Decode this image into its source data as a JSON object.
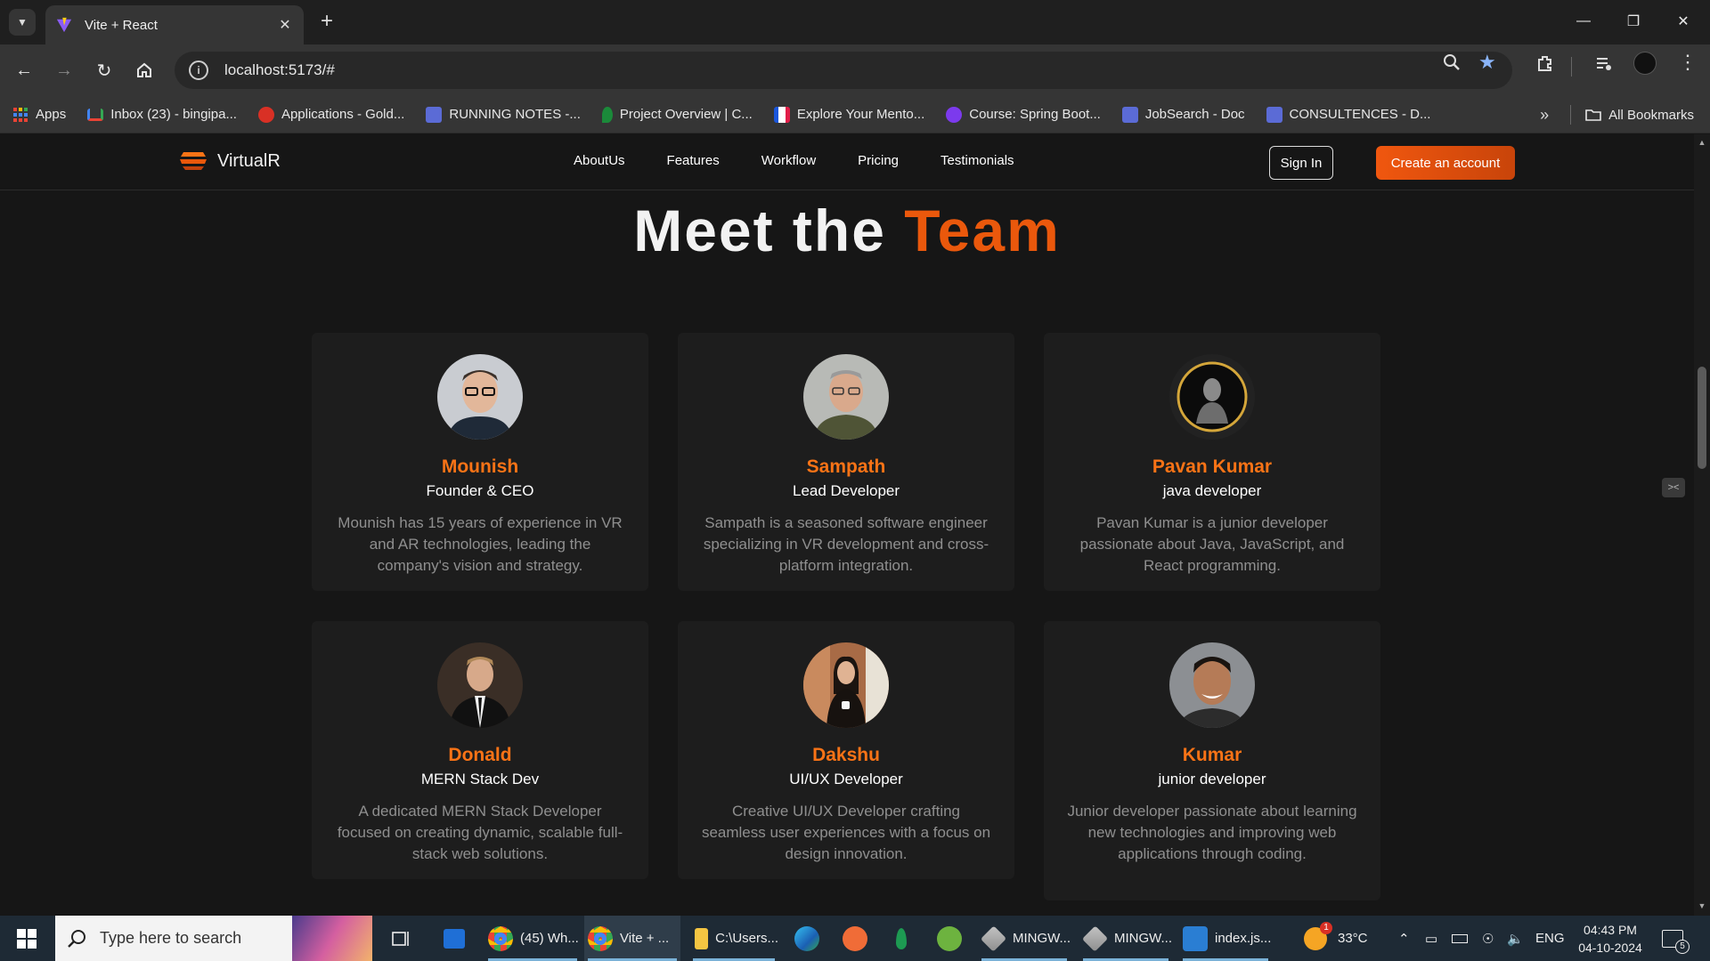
{
  "browser": {
    "tab_title": "Vite + React",
    "url": "localhost:5173/#",
    "bookmarks": [
      {
        "label": "Apps",
        "color": "#4285f4"
      },
      {
        "label": "Inbox (23) - bingipa...",
        "color": "#ea4335"
      },
      {
        "label": "Applications - Gold...",
        "color": "#d93025"
      },
      {
        "label": "RUNNING NOTES -...",
        "color": "#5b6bd6"
      },
      {
        "label": "Project Overview | C...",
        "color": "#1b8a3a"
      },
      {
        "label": "Explore Your Mento...",
        "color": "#e8e8e8"
      },
      {
        "label": "Course: Spring Boot...",
        "color": "#7c3aed"
      },
      {
        "label": "JobSearch - Doc",
        "color": "#5b6bd6"
      },
      {
        "label": "CONSULTENCES - D...",
        "color": "#5b6bd6"
      }
    ],
    "all_bookmarks": "All Bookmarks"
  },
  "site": {
    "brand": "VirtualR",
    "nav": [
      "AboutUs",
      "Features",
      "Workflow",
      "Pricing",
      "Testimonials"
    ],
    "sign_in": "Sign In",
    "create_account": "Create an account",
    "accent": "#ea580c"
  },
  "team": {
    "title_main": "Meet the ",
    "title_accent": "Team",
    "members": [
      {
        "name": "Mounish",
        "role": "Founder & CEO",
        "desc": "Mounish has 15 years of experience in VR and AR technologies, leading the company's vision and strategy."
      },
      {
        "name": "Sampath",
        "role": "Lead Developer",
        "desc": "Sampath is a seasoned software engineer specializing in VR development and cross-platform integration."
      },
      {
        "name": "Pavan Kumar",
        "role": "java developer",
        "desc": "Pavan Kumar is a junior developer passionate about Java, JavaScript, and React programming."
      },
      {
        "name": "Donald",
        "role": "MERN Stack Dev",
        "desc": "A dedicated MERN Stack Developer focused on creating dynamic, scalable full-stack web solutions."
      },
      {
        "name": "Dakshu",
        "role": "UI/UX Developer",
        "desc": "Creative UI/UX Developer crafting seamless user experiences with a focus on design innovation."
      },
      {
        "name": "Kumar",
        "role": "junior developer",
        "desc": "Junior developer passionate about learning new technologies and improving web applications through coding."
      }
    ]
  },
  "taskbar": {
    "search_placeholder": "Type here to search",
    "apps": [
      {
        "label": "(45) Wh...",
        "icon": "chrome-icon"
      },
      {
        "label": "Vite + ...",
        "icon": "chrome-icon"
      },
      {
        "label": "C:\\Users...",
        "icon": "folder-icon"
      },
      {
        "label": "MINGW...",
        "icon": "git-bash-icon"
      },
      {
        "label": "MINGW...",
        "icon": "git-bash-icon"
      },
      {
        "label": "index.js...",
        "icon": "vscode-icon"
      }
    ],
    "weather": "33°C",
    "weather_badge": "1",
    "language": "ENG",
    "time": "04:43 PM",
    "date": "04-10-2024",
    "notifications": "5"
  }
}
